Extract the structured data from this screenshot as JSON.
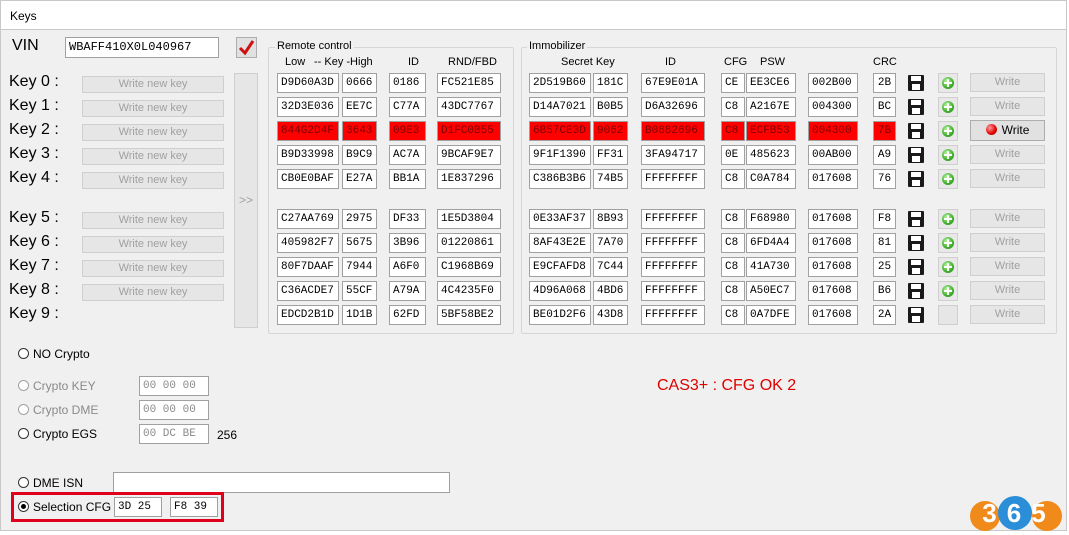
{
  "window": {
    "title": "Keys"
  },
  "vin": {
    "label": "VIN",
    "value": "WBAFF410X0L040967"
  },
  "key_labels": [
    "Key 0 :",
    "Key 1 :",
    "Key 2 :",
    "Key 3 :",
    "Key 4 :",
    "Key 5 :",
    "Key 6 :",
    "Key 7 :",
    "Key 8 :",
    "Key 9 :"
  ],
  "write_new_key_label": "Write new key",
  "arrow_button": ">>",
  "remote_control": {
    "title": "Remote control",
    "headers": {
      "low": "Low",
      "key_high": "-- Key -High",
      "id": "ID",
      "rnd": "RND/FBD"
    },
    "rows": [
      [
        "D9D60A3D",
        "0666",
        "0186",
        "FC521E85"
      ],
      [
        "32D3E036",
        "EE7C",
        "C77A",
        "43DC7767"
      ],
      [
        "844G2D4F",
        "3643",
        "09E3",
        "D1FC0B55"
      ],
      [
        "B9D33998",
        "B9C9",
        "AC7A",
        "9BCAF9E7"
      ],
      [
        "CB0E0BAF",
        "E27A",
        "BB1A",
        "1E837296"
      ],
      [
        "C27AA769",
        "2975",
        "DF33",
        "1E5D3804"
      ],
      [
        "405982F7",
        "5675",
        "3B96",
        "01220861"
      ],
      [
        "80F7DAAF",
        "7944",
        "A6F0",
        "C1968B69"
      ],
      [
        "C36ACDE7",
        "55CF",
        "A79A",
        "4C4235F0"
      ],
      [
        "EDCD2B1D",
        "1D1B",
        "62FD",
        "5BF58BE2"
      ]
    ]
  },
  "immobilizer": {
    "title": "Immobilizer",
    "headers": {
      "secret": "Secret Key",
      "id": "ID",
      "cfg": "CFG",
      "psw": "PSW",
      "crc": "CRC"
    },
    "rows": [
      [
        "2D519B60",
        "181C",
        "67E9E01A",
        "CE",
        "EE3CE6",
        "002B00",
        "2B"
      ],
      [
        "D14A7021",
        "B0B5",
        "D6A32696",
        "C8",
        "A2167E",
        "004300",
        "BC"
      ],
      [
        "6B57CE3D",
        "9062",
        "B0882696",
        "C8",
        "ECFB53",
        "004300",
        "7B"
      ],
      [
        "9F1F1390",
        "FF31",
        "3FA94717",
        "0E",
        "485623",
        "00AB00",
        "A9"
      ],
      [
        "C386B3B6",
        "74B5",
        "FFFFFFFF",
        "C8",
        "C0A784",
        "017608",
        "76"
      ],
      [
        "0E33AF37",
        "8B93",
        "FFFFFFFF",
        "C8",
        "F68980",
        "017608",
        "F8"
      ],
      [
        "8AF43E2E",
        "7A70",
        "FFFFFFFF",
        "C8",
        "6FD4A4",
        "017608",
        "81"
      ],
      [
        "E9CFAFD8",
        "7C44",
        "FFFFFFFF",
        "C8",
        "41A730",
        "017608",
        "25"
      ],
      [
        "4D96A068",
        "4BD6",
        "FFFFFFFF",
        "C8",
        "A50EC7",
        "017608",
        "B6"
      ],
      [
        "BE01D2F6",
        "43D8",
        "FFFFFFFF",
        "C8",
        "0A7DFE",
        "017608",
        "2A"
      ]
    ],
    "write_label": "Write"
  },
  "options": {
    "no_crypto": "NO Crypto",
    "crypto_key": {
      "label": "Crypto KEY",
      "value": "00 00 00"
    },
    "crypto_dme": {
      "label": "Crypto DME",
      "value": "00 00 00"
    },
    "crypto_egs": {
      "label": "Crypto EGS",
      "value": "00 DC BE",
      "extra": "256"
    },
    "dme_isn": {
      "label": "DME ISN",
      "value": ""
    },
    "selection_cfg": {
      "label": "Selection CFG",
      "value1": "3D 25",
      "value2": "F8 39"
    }
  },
  "status": "CAS3+ : CFG OK 2",
  "watermark": "365",
  "colors": {
    "highlight": "#ff0000",
    "status": "#e00000",
    "selection_border": "#e0001b"
  }
}
